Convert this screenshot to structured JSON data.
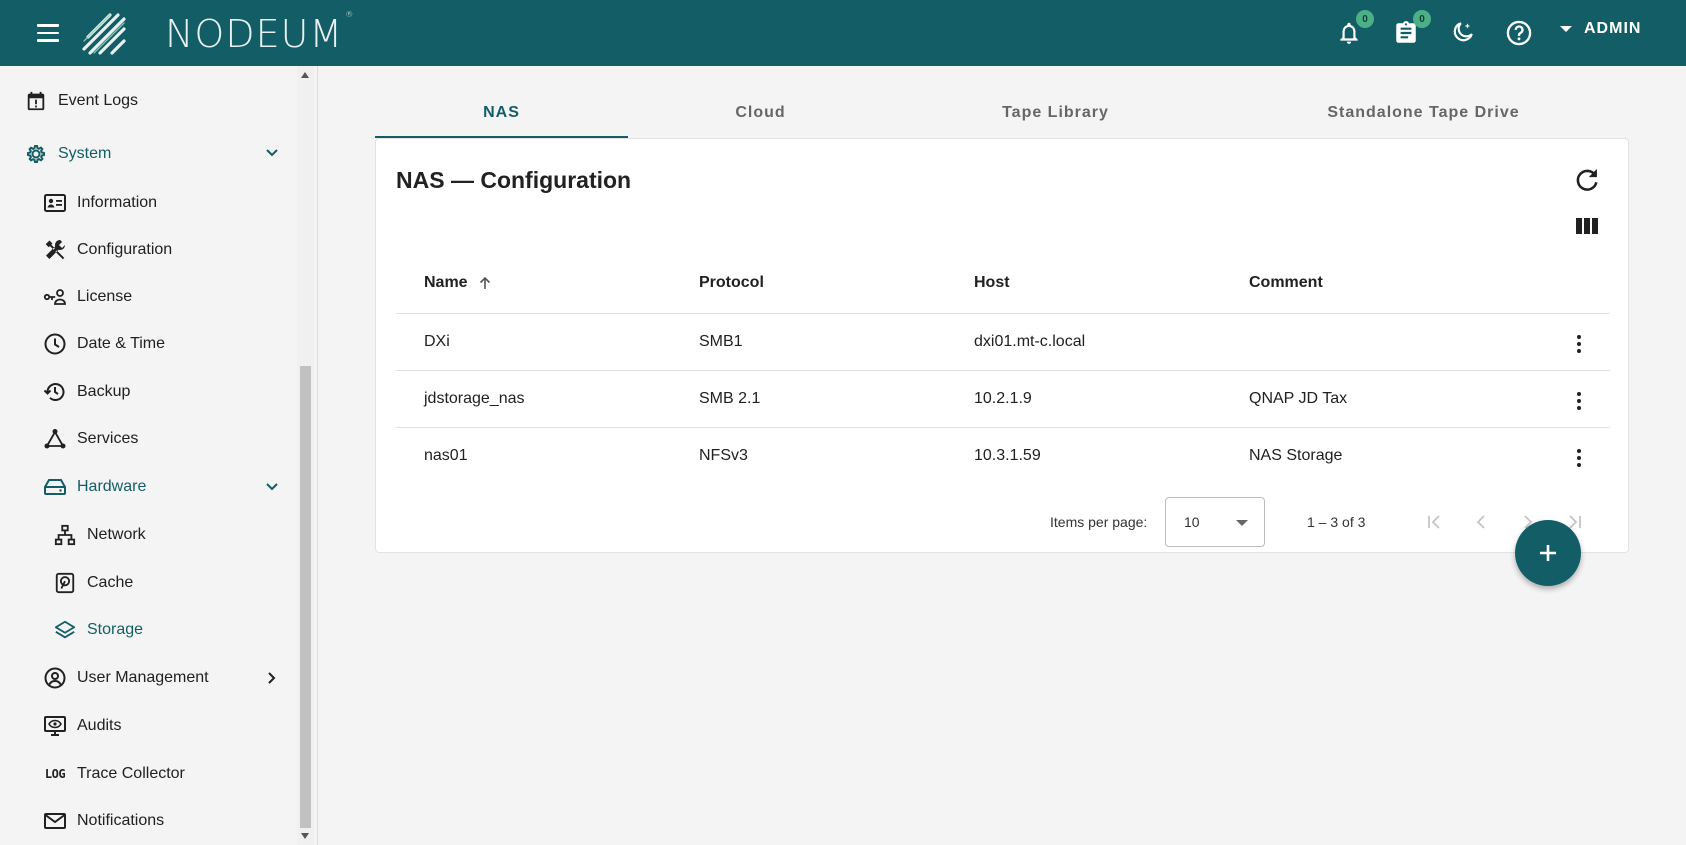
{
  "header": {
    "brand": "NODEUM",
    "brand_mark": "®",
    "notifications_count": "0",
    "tasks_count": "0",
    "user_label": "ADMIN",
    "icons": [
      "menu-icon",
      "bell-icon",
      "clipboard-icon",
      "theme-moon-icon",
      "help-icon"
    ]
  },
  "sidebar": {
    "items": [
      {
        "label": "Event Logs",
        "icon": "calendar-alert-icon"
      },
      {
        "label": "System",
        "icon": "gear-icon",
        "expanded": true
      },
      {
        "label": "Information",
        "icon": "id-card-icon"
      },
      {
        "label": "Configuration",
        "icon": "tools-icon"
      },
      {
        "label": "License",
        "icon": "key-user-icon"
      },
      {
        "label": "Date & Time",
        "icon": "clock-icon"
      },
      {
        "label": "Backup",
        "icon": "backup-history-icon"
      },
      {
        "label": "Services",
        "icon": "services-graph-icon"
      },
      {
        "label": "Hardware",
        "icon": "hardware-icon",
        "expanded": true
      },
      {
        "label": "Network",
        "icon": "network-icon"
      },
      {
        "label": "Cache",
        "icon": "harddisk-icon"
      },
      {
        "label": "Storage",
        "icon": "layers-icon",
        "active": true
      },
      {
        "label": "User Management",
        "icon": "user-circle-icon",
        "expanded": false
      },
      {
        "label": "Audits",
        "icon": "monitor-eye-icon"
      },
      {
        "label": "Trace Collector",
        "icon": "log-icon",
        "icon_text": "LOG"
      },
      {
        "label": "Notifications",
        "icon": "mail-icon"
      }
    ]
  },
  "tabs": [
    {
      "label": "NAS",
      "active": true
    },
    {
      "label": "Cloud",
      "active": false
    },
    {
      "label": "Tape Library",
      "active": false
    },
    {
      "label": "Standalone Tape Drive",
      "active": false
    }
  ],
  "card": {
    "title": "NAS — Configuration"
  },
  "table": {
    "columns": [
      "Name",
      "Protocol",
      "Host",
      "Comment"
    ],
    "sorted_column": "Name",
    "rows": [
      {
        "name": "DXi",
        "protocol": "SMB1",
        "host": "dxi01.mt-c.local",
        "comment": ""
      },
      {
        "name": "jdstorage_nas",
        "protocol": "SMB 2.1",
        "host": "10.2.1.9",
        "comment": "QNAP JD Tax"
      },
      {
        "name": "nas01",
        "protocol": "NFSv3",
        "host": "10.3.1.59",
        "comment": "NAS Storage"
      }
    ]
  },
  "paginator": {
    "items_per_page_label": "Items per page:",
    "page_size": "10",
    "range": "1 – 3 of 3"
  },
  "colors": {
    "primary": "#135e66",
    "background": "#f4f4f4",
    "badge": "#4caf85"
  }
}
